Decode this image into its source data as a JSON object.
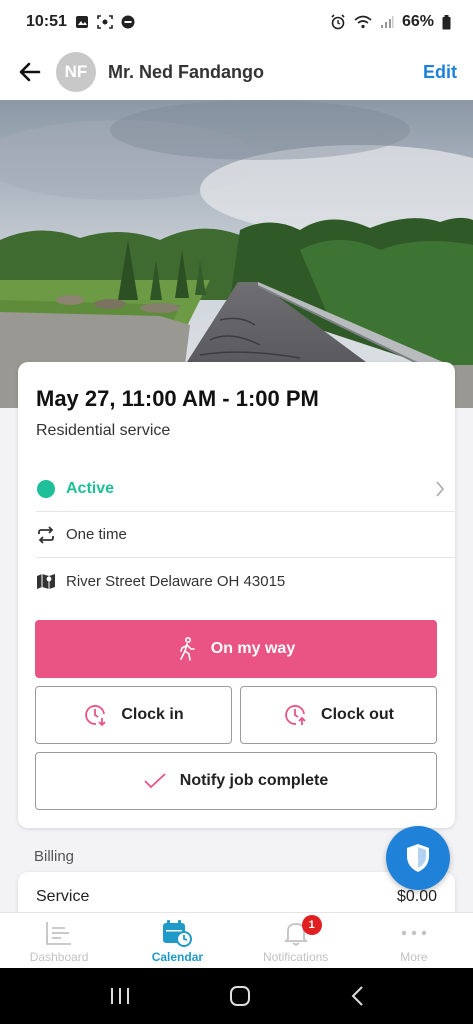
{
  "status_bar": {
    "time": "10:51",
    "battery": "66%"
  },
  "header": {
    "avatar_initials": "NF",
    "client_name": "Mr. Ned Fandango",
    "edit_label": "Edit"
  },
  "job": {
    "date_time": "May 27, 11:00 AM - 1:00 PM",
    "service_type": "Residential service",
    "status": "Active",
    "frequency": "One time",
    "address": "River Street Delaware OH 43015"
  },
  "actions": {
    "on_my_way": "On my way",
    "clock_in": "Clock in",
    "clock_out": "Clock out",
    "notify_complete": "Notify job complete"
  },
  "billing": {
    "section_label": "Billing",
    "service_label": "Service",
    "service_amount": "$0.00"
  },
  "tabs": [
    {
      "label": "Dashboard",
      "icon": "dashboard-icon"
    },
    {
      "label": "Calendar",
      "icon": "calendar-icon"
    },
    {
      "label": "Notifications",
      "icon": "bell-icon",
      "badge": "1"
    },
    {
      "label": "More",
      "icon": "more-icon"
    }
  ],
  "colors": {
    "accent": "#1f82d8",
    "active_green": "#1fbf9a",
    "primary_button": "#ea5484",
    "calendar_tab": "#1f9ac9"
  }
}
